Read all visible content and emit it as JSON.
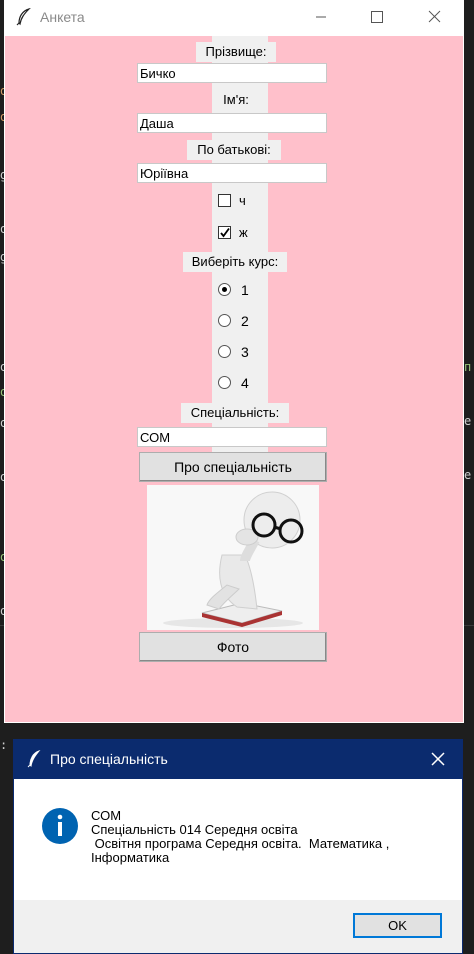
{
  "main_window": {
    "title": "Анкета",
    "surname_label": "Прізвище:",
    "surname_value": "Бичко",
    "name_label": "Ім'я:",
    "name_value": "Даша",
    "patronymic_label": "По батькові:",
    "patronymic_value": "Юріївна",
    "gender_male_label": "ч",
    "gender_male_checked": false,
    "gender_female_label": "ж",
    "gender_female_checked": true,
    "course_label": "Виберіть курс:",
    "courses": [
      "1",
      "2",
      "3",
      "4"
    ],
    "selected_course": "1",
    "specialty_label": "Спеціальність:",
    "specialty_value": "СОМ",
    "about_button": "Про спеціальність",
    "photo_button": "Фото"
  },
  "dialog": {
    "title": "Про спеціальність",
    "message": "СОМ\nСпеціальність 014 Середня освіта\n Освітня програма Середня освіта.  Математика ,\nІнформатика",
    "ok_button": "OK"
  },
  "colors": {
    "client_bg": "#ffc0cb",
    "dialog_title_bg": "#0b2b6e",
    "info_icon": "#0063b1"
  }
}
